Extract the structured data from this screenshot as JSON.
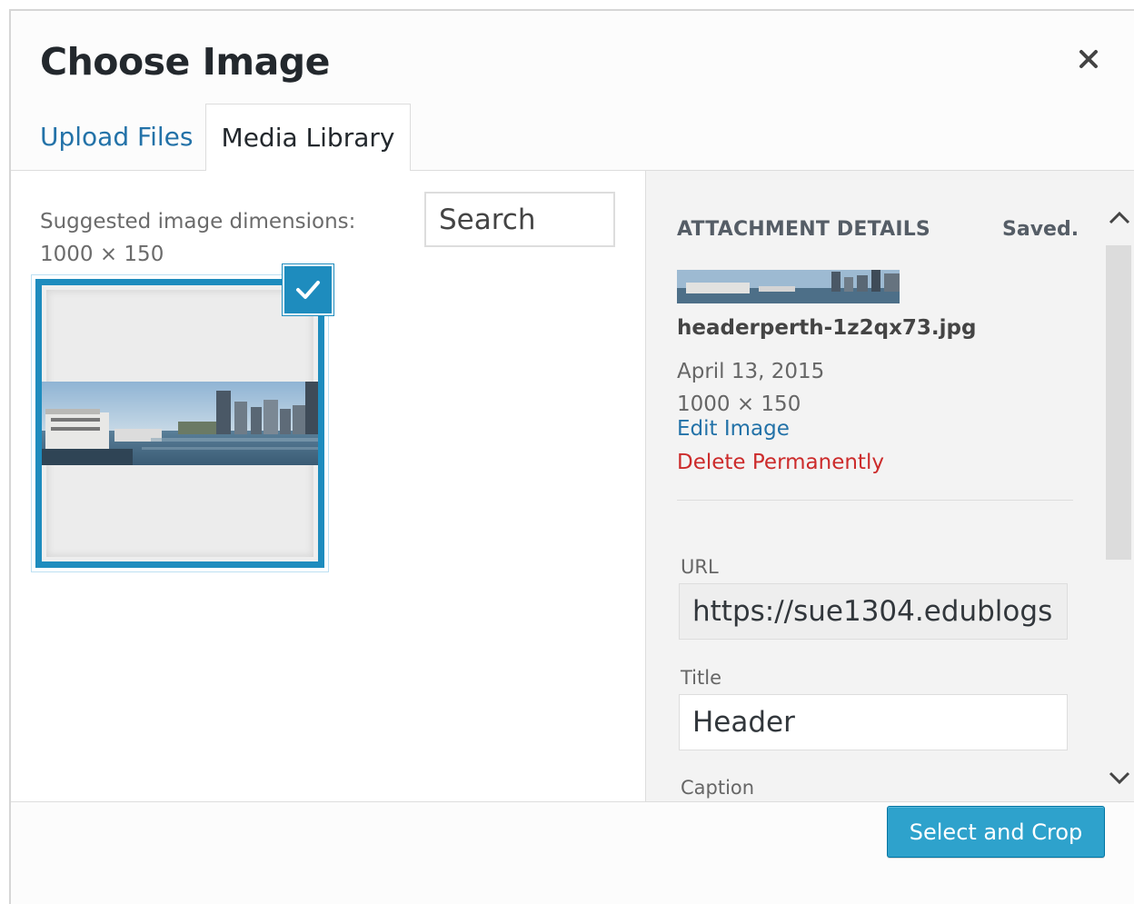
{
  "modal": {
    "title": "Choose Image",
    "close_icon": "close-x-icon"
  },
  "tabs": [
    {
      "label": "Upload Files",
      "active": false
    },
    {
      "label": "Media Library",
      "active": true
    }
  ],
  "library": {
    "suggested_label": "Suggested image dimensions:",
    "suggested_dims": "1000 × 150",
    "search_placeholder": "Search",
    "selected_icon": "checkmark-icon"
  },
  "details": {
    "heading": "ATTACHMENT DETAILS",
    "status": "Saved.",
    "filename": "headerperth-1z2qx73.jpg",
    "date": "April 13, 2015",
    "dimensions": "1000 × 150",
    "edit_link": "Edit Image",
    "delete_link": "Delete Permanently",
    "fields": {
      "url_label": "URL",
      "url_value": "https://sue1304.edublogs.",
      "title_label": "Title",
      "title_value": "Header",
      "caption_label": "Caption"
    }
  },
  "toolbar": {
    "select_crop_label": "Select and Crop"
  },
  "colors": {
    "accent": "#1e8cbe",
    "link": "#2372a8",
    "delete": "#cc2b2b",
    "button": "#2ea2cc"
  }
}
